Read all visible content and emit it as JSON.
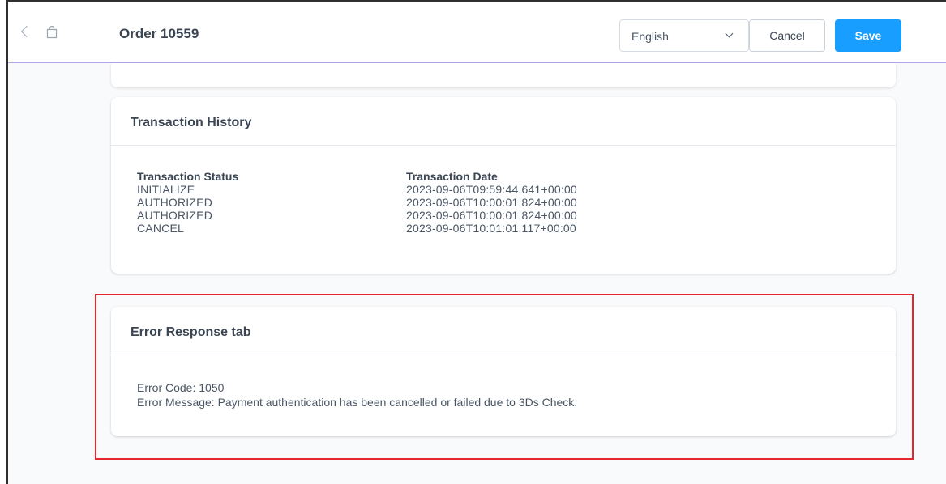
{
  "header": {
    "title": "Order 10559",
    "language": "English",
    "cancel_label": "Cancel",
    "save_label": "Save"
  },
  "transaction_history": {
    "title": "Transaction History",
    "columns": [
      "Transaction Status",
      "Transaction Date"
    ],
    "rows": [
      [
        "INITIALIZE",
        "2023-09-06T09:59:44.641+00:00"
      ],
      [
        "AUTHORIZED",
        "2023-09-06T10:00:01.824+00:00"
      ],
      [
        "AUTHORIZED",
        "2023-09-06T10:00:01.824+00:00"
      ],
      [
        "CANCEL",
        "2023-09-06T10:01:01.117+00:00"
      ]
    ]
  },
  "error_response": {
    "title": "Error Response tab",
    "code_line": "Error Code: 1050",
    "message_line": "Error Message: Payment authentication has been cancelled or failed due to 3Ds Check."
  },
  "icons": {
    "back": "chevron-left-icon",
    "order": "shopping-bag-icon",
    "language_dropdown": "chevron-down-icon"
  },
  "colors": {
    "accent": "#189eff",
    "highlight": "#e6252c",
    "header_border": "#b7a6e0"
  }
}
